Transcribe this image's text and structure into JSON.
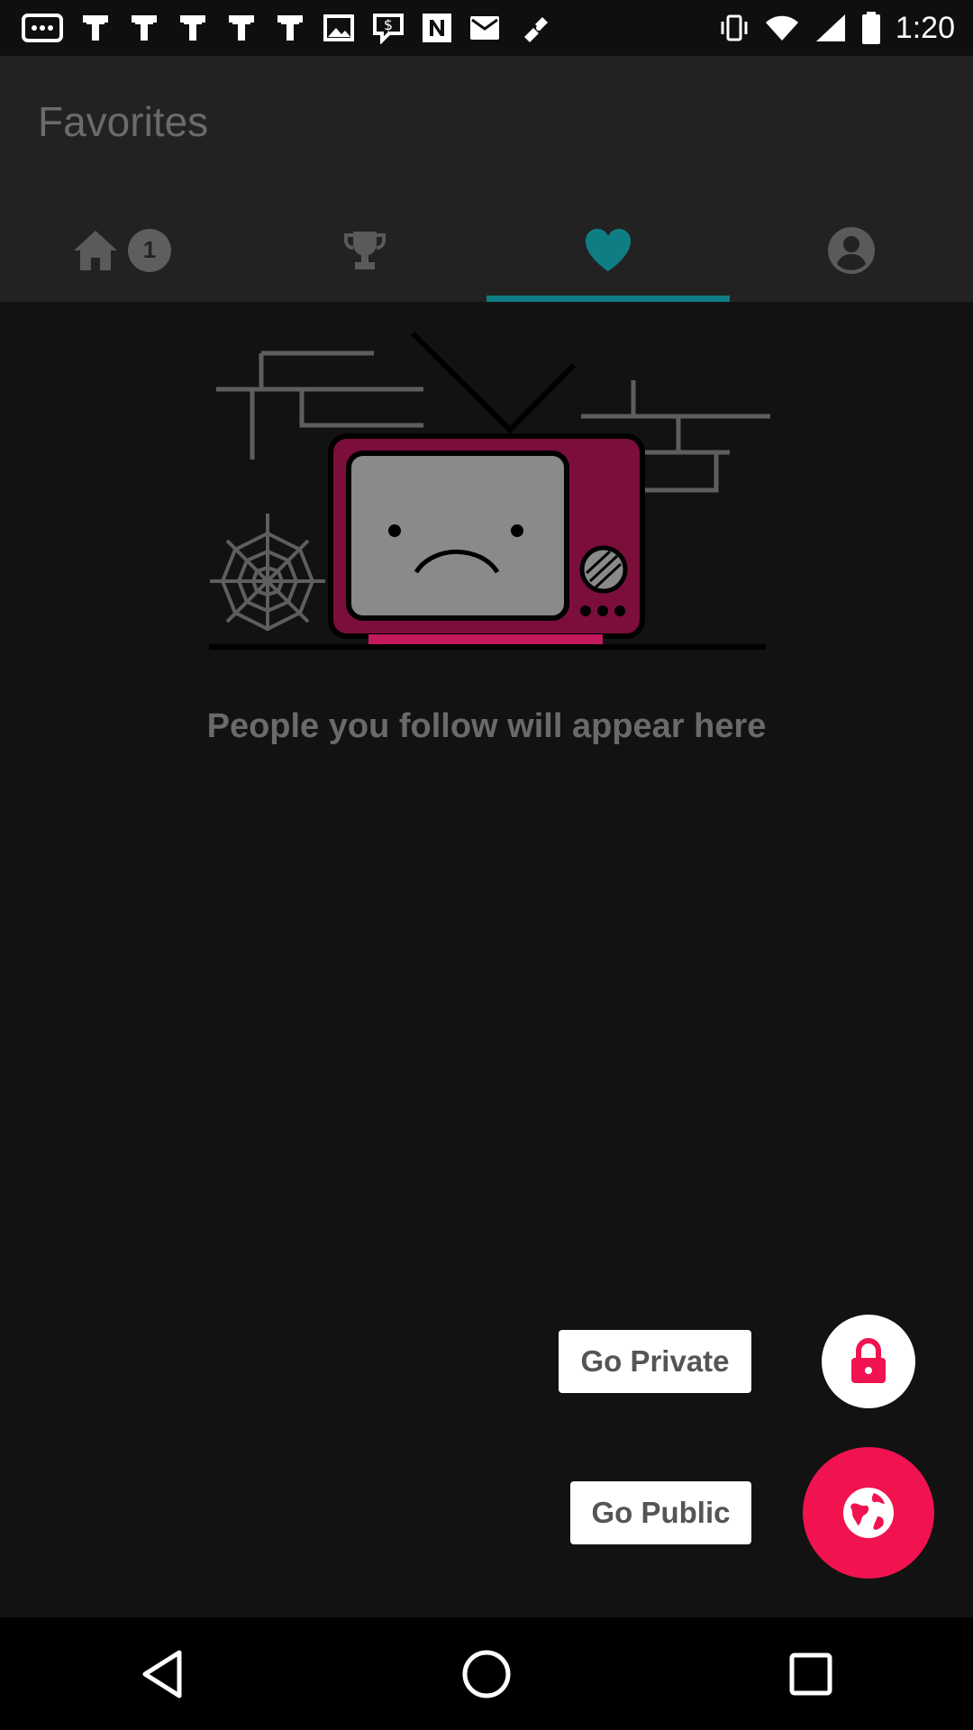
{
  "status_bar": {
    "time": "1:20",
    "icons": [
      "chat-dots-icon",
      "notification-icon",
      "notification-icon",
      "notification-icon",
      "notification-icon",
      "notification-icon",
      "image-icon",
      "cash-app-icon",
      "n-app-icon",
      "mail-icon",
      "fake-gps-icon",
      "vibrate-icon",
      "wifi-icon",
      "signal-icon",
      "battery-icon"
    ]
  },
  "header": {
    "title": "Favorites",
    "tabs": [
      {
        "name": "home",
        "icon": "home-icon",
        "badge": "1"
      },
      {
        "name": "leaderboard",
        "icon": "trophy-icon"
      },
      {
        "name": "favorites",
        "icon": "heart-icon",
        "active": true
      },
      {
        "name": "profile",
        "icon": "profile-icon"
      }
    ],
    "active_color": "#0f7d84"
  },
  "empty_state": {
    "illustration": "sad-tv-illustration",
    "message": "People you follow will appear here"
  },
  "actions": {
    "private_label": "Go Private",
    "public_label": "Go Public",
    "accent_color": "#f0134f"
  },
  "nav": {
    "buttons": [
      "back-icon",
      "home-icon",
      "recents-icon"
    ]
  }
}
